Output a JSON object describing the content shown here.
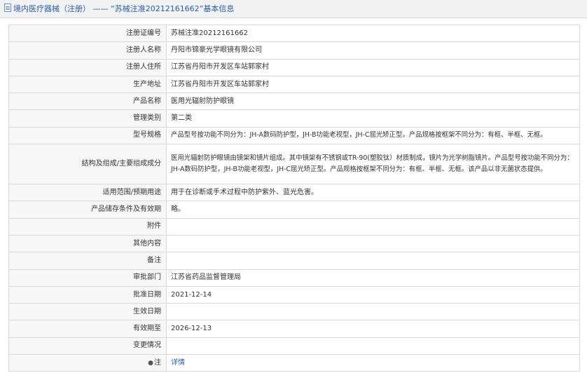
{
  "header": {
    "category": "境内医疗器械（注册）",
    "separator": "——",
    "title": "“苏械注准20212161662”基本信息"
  },
  "rows": [
    {
      "label": "注册证编号",
      "value": "苏械注准20212161662"
    },
    {
      "label": "注册人名称",
      "value": "丹阳市锦豪光学眼镜有限公司"
    },
    {
      "label": "注册人住所",
      "value": "江苏省丹阳市开发区车站郭家村"
    },
    {
      "label": "生产地址",
      "value": "江苏省丹阳市开发区车站郭家村"
    },
    {
      "label": "产品名称",
      "value": "医用光辐射防护眼镜"
    },
    {
      "label": "管理类别",
      "value": "第二类"
    },
    {
      "label": "型号规格",
      "value": "产品型号按功能不同分为：JH-A数码防护型，JH-B功能老视型，JH-C屈光矫正型。产品规格按框架不同分为：有框、半框、无框。"
    },
    {
      "label": "结构及组成/主要组成成分",
      "value": "医用光辐射防护眼镜由镜架和镜片组成。其中镜架有不锈钢或TR-90(塑胶钛）材质制成，镜片为光学树脂镜片。产品型号按功能不同分为：JH-A数码防护型，JH-B功能老视型，JH-C屈光矫正型。产品规格按框架不同分为：有框、半框、无框。该产品以非无菌状态提供。"
    },
    {
      "label": "适用范围/预期用途",
      "value": "用于在诊断或手术过程中防护紫外、蓝光危害。"
    },
    {
      "label": "产品储存条件及有效期",
      "value": "略。"
    },
    {
      "label": "附件",
      "value": ""
    },
    {
      "label": "其他内容",
      "value": ""
    },
    {
      "label": "备注",
      "value": ""
    },
    {
      "label": "审批部门",
      "value": "江苏省药品监督管理局"
    },
    {
      "label": "批准日期",
      "value": "2021-12-14"
    },
    {
      "label": "生效日期",
      "value": ""
    },
    {
      "label": "有效期至",
      "value": "2026-12-13"
    },
    {
      "label": "变更情况",
      "value": ""
    }
  ],
  "note": {
    "icon": "●",
    "label": "注",
    "link_text": "详情"
  }
}
